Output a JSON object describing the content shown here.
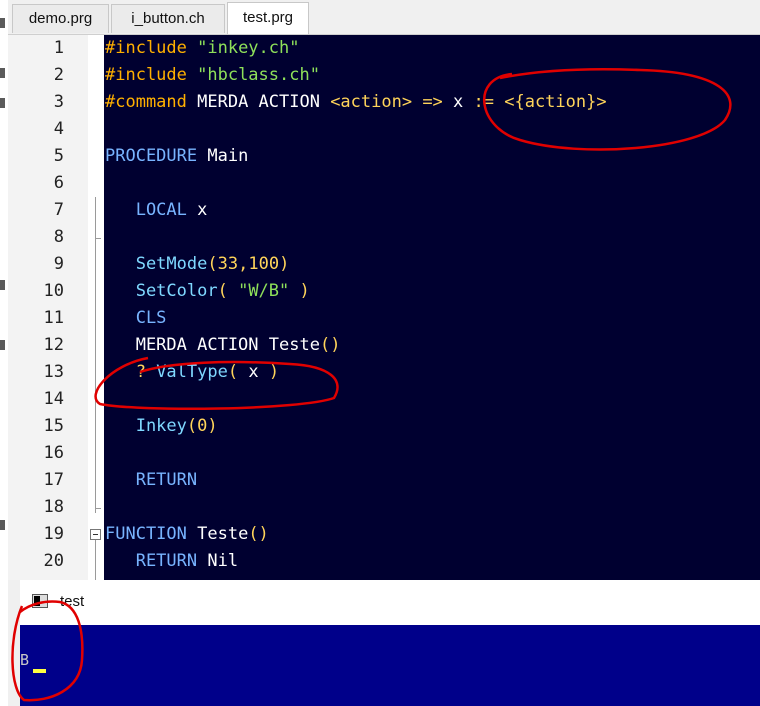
{
  "tabs": [
    {
      "label": "demo.prg",
      "active": false
    },
    {
      "label": "i_button.ch",
      "active": false
    },
    {
      "label": "test.prg",
      "active": true
    }
  ],
  "editor": {
    "lines": [
      {
        "num": "1",
        "tokens": [
          {
            "t": "#include ",
            "c": "pre"
          },
          {
            "t": "\"inkey.ch\"",
            "c": "str"
          }
        ]
      },
      {
        "num": "2",
        "tokens": [
          {
            "t": "#include ",
            "c": "pre"
          },
          {
            "t": "\"hbclass.ch\"",
            "c": "str"
          }
        ]
      },
      {
        "num": "3",
        "tokens": [
          {
            "t": "#command ",
            "c": "pre"
          },
          {
            "t": "MERDA ACTION ",
            "c": "txt"
          },
          {
            "t": "<action>",
            "c": "op"
          },
          {
            "t": " => ",
            "c": "op"
          },
          {
            "t": "x",
            "c": "txt"
          },
          {
            "t": " := ",
            "c": "op"
          },
          {
            "t": "<{action}>",
            "c": "op"
          }
        ]
      },
      {
        "num": "4",
        "tokens": []
      },
      {
        "num": "5",
        "tokens": [
          {
            "t": "PROCEDURE ",
            "c": "kw"
          },
          {
            "t": "Main",
            "c": "txt"
          }
        ]
      },
      {
        "num": "6",
        "tokens": []
      },
      {
        "num": "7",
        "tokens": [
          {
            "t": "   LOCAL ",
            "c": "kw"
          },
          {
            "t": "x",
            "c": "txt"
          }
        ]
      },
      {
        "num": "8",
        "tokens": []
      },
      {
        "num": "9",
        "tokens": [
          {
            "t": "   SetMode",
            "c": "fn"
          },
          {
            "t": "(",
            "c": "op"
          },
          {
            "t": "33",
            "c": "num"
          },
          {
            "t": ",",
            "c": "op"
          },
          {
            "t": "100",
            "c": "num"
          },
          {
            "t": ")",
            "c": "op"
          }
        ]
      },
      {
        "num": "10",
        "tokens": [
          {
            "t": "   SetColor",
            "c": "fn"
          },
          {
            "t": "( ",
            "c": "op"
          },
          {
            "t": "\"W/B\"",
            "c": "str"
          },
          {
            "t": " )",
            "c": "op"
          }
        ]
      },
      {
        "num": "11",
        "tokens": [
          {
            "t": "   CLS",
            "c": "kw"
          }
        ]
      },
      {
        "num": "12",
        "tokens": [
          {
            "t": "   MERDA ACTION ",
            "c": "txt"
          },
          {
            "t": "Teste",
            "c": "txt"
          },
          {
            "t": "()",
            "c": "op"
          }
        ]
      },
      {
        "num": "13",
        "tokens": [
          {
            "t": "   ? ",
            "c": "op"
          },
          {
            "t": "ValType",
            "c": "fn"
          },
          {
            "t": "( ",
            "c": "op"
          },
          {
            "t": "x",
            "c": "txt"
          },
          {
            "t": " )",
            "c": "op"
          }
        ]
      },
      {
        "num": "14",
        "tokens": []
      },
      {
        "num": "15",
        "tokens": [
          {
            "t": "   Inkey",
            "c": "fn"
          },
          {
            "t": "(",
            "c": "op"
          },
          {
            "t": "0",
            "c": "num"
          },
          {
            "t": ")",
            "c": "op"
          }
        ]
      },
      {
        "num": "16",
        "tokens": []
      },
      {
        "num": "17",
        "tokens": [
          {
            "t": "   RETURN",
            "c": "kw"
          }
        ]
      },
      {
        "num": "18",
        "tokens": []
      },
      {
        "num": "19",
        "tokens": [
          {
            "t": "FUNCTION ",
            "c": "kw"
          },
          {
            "t": "Teste",
            "c": "txt"
          },
          {
            "t": "()",
            "c": "op"
          }
        ]
      },
      {
        "num": "20",
        "tokens": [
          {
            "t": "   RETURN ",
            "c": "kw"
          },
          {
            "t": "Nil",
            "c": "txt"
          }
        ]
      }
    ]
  },
  "terminal": {
    "title": "test",
    "icon": "console-window-icon",
    "output": "B"
  },
  "colors": {
    "editor_bg": "#000030",
    "terminal_bg": "#00008a",
    "annotation": "#e00000"
  }
}
